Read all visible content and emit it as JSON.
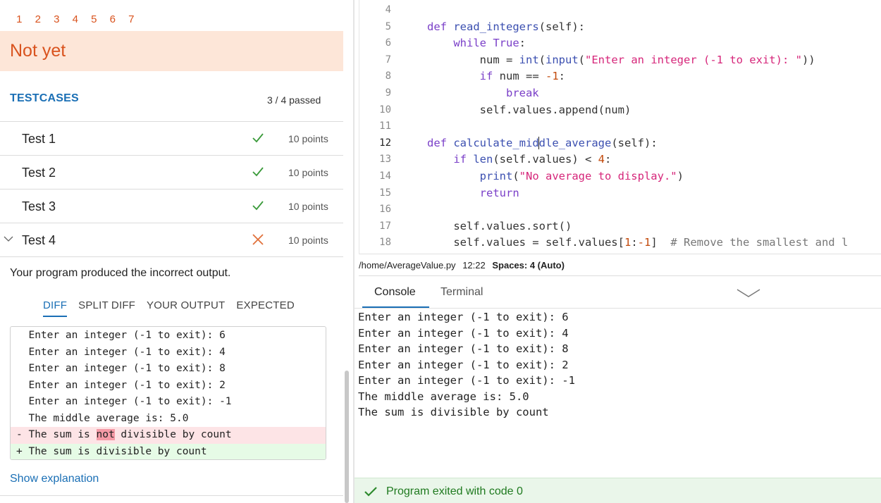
{
  "steps": [
    "1",
    "2",
    "3",
    "4",
    "5",
    "6",
    "7"
  ],
  "status": "Not yet",
  "testcases": {
    "heading": "TESTCASES",
    "passed": "3 / 4 passed",
    "tests": [
      {
        "name": "Test 1",
        "points": "10 points",
        "result": "pass"
      },
      {
        "name": "Test 2",
        "points": "10 points",
        "result": "pass"
      },
      {
        "name": "Test 3",
        "points": "10 points",
        "result": "pass"
      },
      {
        "name": "Test 4",
        "points": "10 points",
        "result": "fail"
      }
    ]
  },
  "feedback": {
    "message": "Your program produced the incorrect output.",
    "tabs": [
      "DIFF",
      "SPLIT DIFF",
      "YOUR OUTPUT",
      "EXPECTED"
    ],
    "diff": {
      "common": [
        "Enter an integer (-1 to exit): 6",
        "Enter an integer (-1 to exit): 4",
        "Enter an integer (-1 to exit): 8",
        "Enter an integer (-1 to exit): 2",
        "Enter an integer (-1 to exit): -1",
        "The middle average is: 5.0"
      ],
      "removed": {
        "prefix": "- The sum is ",
        "highlight": "not",
        "suffix": " divisible by count"
      },
      "added": "+ The sum is divisible by count"
    },
    "show_explanation": "Show explanation"
  },
  "editor": {
    "lines": [
      {
        "n": "4",
        "indent": "",
        "tokens": []
      },
      {
        "n": "5",
        "indent": "",
        "tokens": [
          [
            "kw",
            "def"
          ],
          [
            "p",
            " "
          ],
          [
            "fn",
            "read_integers"
          ],
          [
            "p",
            "(self):"
          ]
        ]
      },
      {
        "n": "6",
        "indent": "    ",
        "tokens": [
          [
            "kw",
            "while"
          ],
          [
            "p",
            " "
          ],
          [
            "kw",
            "True"
          ],
          [
            "p",
            ":"
          ]
        ]
      },
      {
        "n": "7",
        "indent": "        ",
        "tokens": [
          [
            "p",
            "num = "
          ],
          [
            "fn",
            "int"
          ],
          [
            "p",
            "("
          ],
          [
            "fn",
            "input"
          ],
          [
            "p",
            "("
          ],
          [
            "st",
            "\"Enter an integer (-1 to exit): \""
          ],
          [
            "p",
            "))"
          ]
        ]
      },
      {
        "n": "8",
        "indent": "        ",
        "tokens": [
          [
            "kw",
            "if"
          ],
          [
            "p",
            " num == "
          ],
          [
            "nm",
            "-1"
          ],
          [
            "p",
            ":"
          ]
        ]
      },
      {
        "n": "9",
        "indent": "            ",
        "tokens": [
          [
            "kw",
            "break"
          ]
        ]
      },
      {
        "n": "10",
        "indent": "        ",
        "tokens": [
          [
            "p",
            "self.values.append(num)"
          ]
        ]
      },
      {
        "n": "11",
        "indent": "",
        "tokens": []
      },
      {
        "n": "12",
        "indent": "",
        "tokens": [
          [
            "kw",
            "def"
          ],
          [
            "p",
            " "
          ],
          [
            "fn",
            "calculate_mid"
          ],
          [
            "caret",
            ""
          ],
          [
            "fn",
            "dle_average"
          ],
          [
            "p",
            "(self):"
          ]
        ]
      },
      {
        "n": "13",
        "indent": "    ",
        "tokens": [
          [
            "kw",
            "if"
          ],
          [
            "p",
            " "
          ],
          [
            "fn",
            "len"
          ],
          [
            "p",
            "(self.values) < "
          ],
          [
            "nm",
            "4"
          ],
          [
            "p",
            ":"
          ]
        ]
      },
      {
        "n": "14",
        "indent": "        ",
        "tokens": [
          [
            "fn",
            "print"
          ],
          [
            "p",
            "("
          ],
          [
            "st",
            "\"No average to display.\""
          ],
          [
            "p",
            ")"
          ]
        ]
      },
      {
        "n": "15",
        "indent": "        ",
        "tokens": [
          [
            "kw",
            "return"
          ]
        ]
      },
      {
        "n": "16",
        "indent": "",
        "tokens": []
      },
      {
        "n": "17",
        "indent": "    ",
        "tokens": [
          [
            "p",
            "self.values.sort()"
          ]
        ]
      },
      {
        "n": "18",
        "indent": "    ",
        "tokens": [
          [
            "p",
            "self.values = self.values["
          ],
          [
            "nm",
            "1"
          ],
          [
            "p",
            ":"
          ],
          [
            "nm",
            "-1"
          ],
          [
            "p",
            "]  "
          ],
          [
            "cm",
            "# Remove the smallest and l"
          ]
        ]
      }
    ],
    "current_line": "12"
  },
  "file_status": {
    "path": "/home/AverageValue.py",
    "position": "12:22",
    "spaces": "Spaces: 4 (Auto)"
  },
  "console": {
    "tabs": [
      "Console",
      "Terminal"
    ],
    "output": [
      "Enter an integer (-1 to exit): 6",
      "Enter an integer (-1 to exit): 4",
      "Enter an integer (-1 to exit): 8",
      "Enter an integer (-1 to exit): 2",
      "Enter an integer (-1 to exit): -1",
      "The middle average is: 5.0",
      "The sum is divisible by count"
    ],
    "exit_message": "Program exited with code 0"
  },
  "colors": {
    "accent_orange": "#d9531e",
    "accent_blue": "#1a6fb5",
    "pass_green": "#3a9a3a",
    "fail_orange": "#e0703a"
  }
}
